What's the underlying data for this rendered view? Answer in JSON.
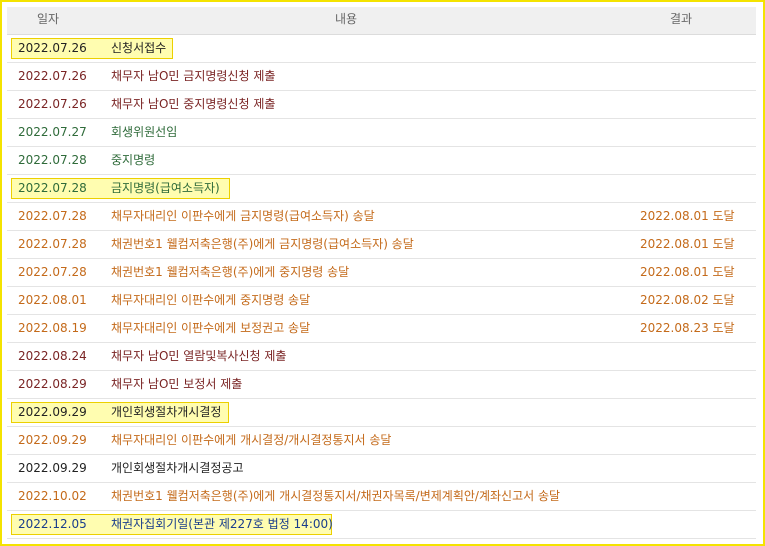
{
  "header": {
    "date": "일자",
    "content": "내용",
    "result": "결과"
  },
  "colors": {
    "black": "#222222",
    "maroon": "#7a2424",
    "green": "#2f6b3a",
    "orange": "#c46a1a",
    "blue": "#1a3d8c",
    "highlight": "#fffdb0"
  },
  "rows": [
    {
      "date": "2022.07.26",
      "content": "신청서접수",
      "result": "",
      "color": "black",
      "highlight": true
    },
    {
      "date": "2022.07.26",
      "content": "채무자 남O민 금지명령신청 제출",
      "result": "",
      "color": "maroon",
      "highlight": false
    },
    {
      "date": "2022.07.26",
      "content": "채무자 남O민 중지명령신청 제출",
      "result": "",
      "color": "maroon",
      "highlight": false
    },
    {
      "date": "2022.07.27",
      "content": "회생위원선임",
      "result": "",
      "color": "green",
      "highlight": false
    },
    {
      "date": "2022.07.28",
      "content": "중지명령",
      "result": "",
      "color": "green",
      "highlight": false
    },
    {
      "date": "2022.07.28",
      "content": "금지명령(급여소득자)",
      "result": "",
      "color": "green",
      "highlight": true
    },
    {
      "date": "2022.07.28",
      "content": "채무자대리인 이판수에게 금지명령(급여소득자) 송달",
      "result": "2022.08.01 도달",
      "color": "orange",
      "highlight": false
    },
    {
      "date": "2022.07.28",
      "content": "채권번호1 웰컴저축은행(주)에게 금지명령(급여소득자) 송달",
      "result": "2022.08.01 도달",
      "color": "orange",
      "highlight": false
    },
    {
      "date": "2022.07.28",
      "content": "채권번호1 웰컴저축은행(주)에게 중지명령 송달",
      "result": "2022.08.01 도달",
      "color": "orange",
      "highlight": false
    },
    {
      "date": "2022.08.01",
      "content": "채무자대리인 이판수에게 중지명령 송달",
      "result": "2022.08.02 도달",
      "color": "orange",
      "highlight": false
    },
    {
      "date": "2022.08.19",
      "content": "채무자대리인 이판수에게 보정권고 송달",
      "result": "2022.08.23 도달",
      "color": "orange",
      "highlight": false
    },
    {
      "date": "2022.08.24",
      "content": "채무자 남O민 열람및복사신청 제출",
      "result": "",
      "color": "maroon",
      "highlight": false
    },
    {
      "date": "2022.08.29",
      "content": "채무자 남O민 보정서 제출",
      "result": "",
      "color": "maroon",
      "highlight": false
    },
    {
      "date": "2022.09.29",
      "content": "개인회생절차개시결정",
      "result": "",
      "color": "black",
      "highlight": true
    },
    {
      "date": "2022.09.29",
      "content": "채무자대리인 이판수에게 개시결정/개시결정통지서 송달",
      "result": "",
      "color": "orange",
      "highlight": false
    },
    {
      "date": "2022.09.29",
      "content": "개인회생절차개시결정공고",
      "result": "",
      "color": "black",
      "highlight": false
    },
    {
      "date": "2022.10.02",
      "content": "채권번호1 웰컴저축은행(주)에게 개시결정통지서/채권자목록/변제계획안/계좌신고서 송달",
      "result": "",
      "color": "orange",
      "highlight": false
    },
    {
      "date": "2022.12.05",
      "content": "채권자집회기일(본관 제227호 법정 14:00)",
      "result": "",
      "color": "blue",
      "highlight": true
    }
  ]
}
